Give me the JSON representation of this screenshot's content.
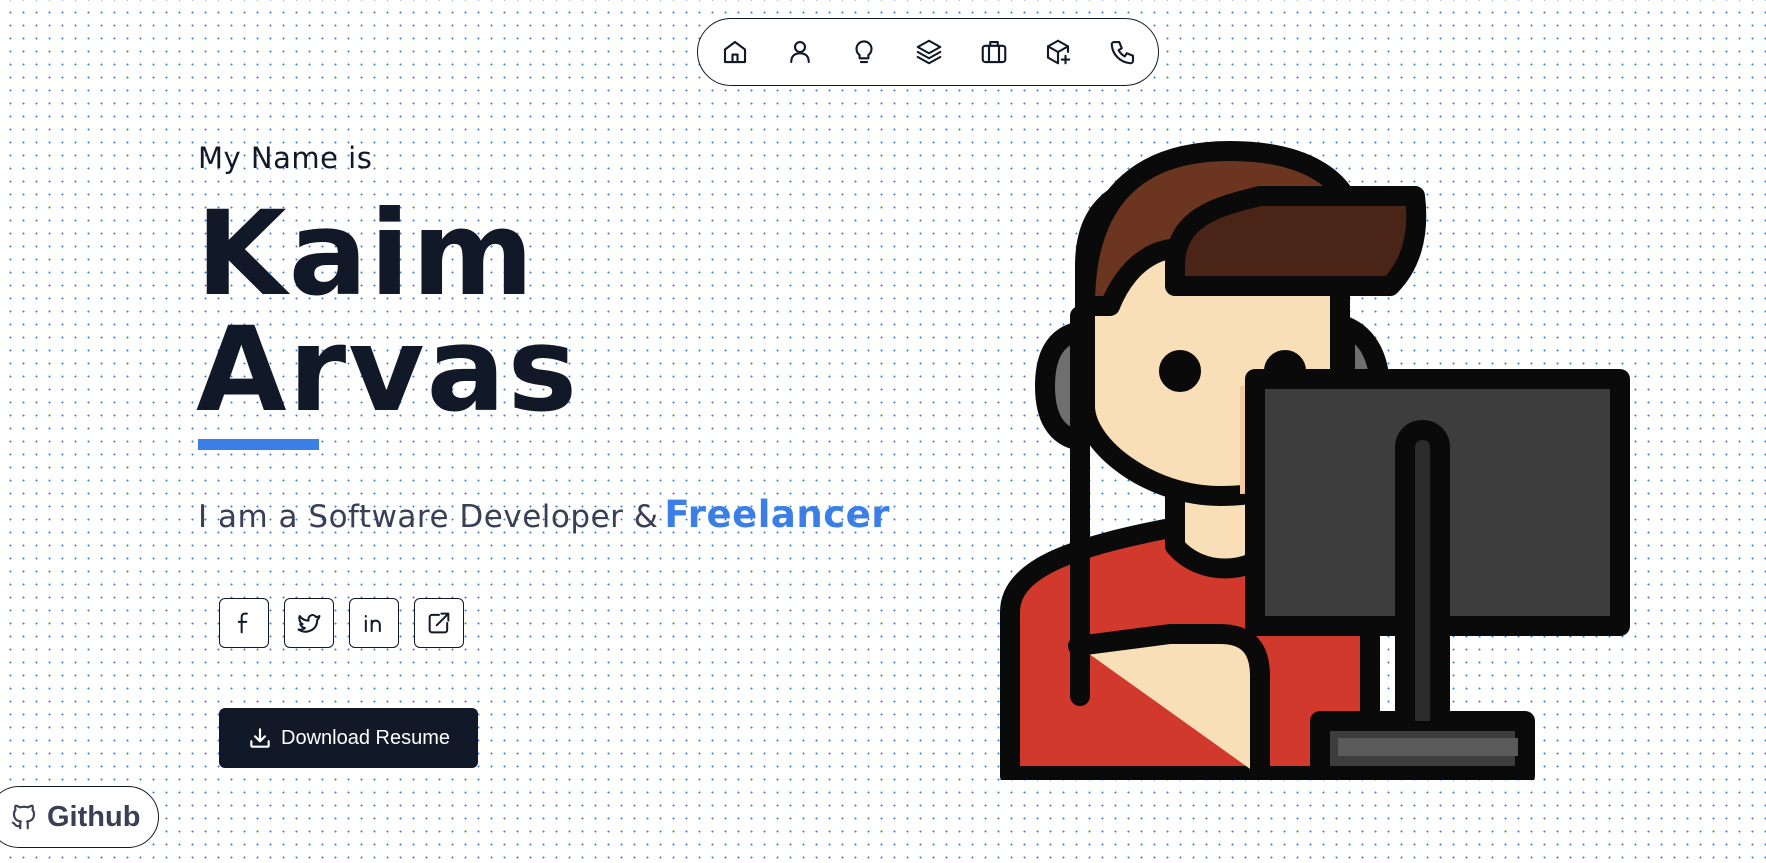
{
  "nav": {
    "items": [
      {
        "icon": "home-icon"
      },
      {
        "icon": "user-icon"
      },
      {
        "icon": "lightbulb-icon"
      },
      {
        "icon": "layers-icon"
      },
      {
        "icon": "briefcase-icon"
      },
      {
        "icon": "box-add-icon"
      },
      {
        "icon": "phone-icon"
      }
    ]
  },
  "hero": {
    "intro": "My Name is",
    "first_name": "Kaim",
    "last_name": "Arvas",
    "tagline_prefix": "I am a Software Developer &",
    "tagline_accent": "Freelancer"
  },
  "social": [
    {
      "icon": "facebook-icon"
    },
    {
      "icon": "twitter-icon"
    },
    {
      "icon": "linkedin-icon"
    },
    {
      "icon": "external-link-icon"
    }
  ],
  "download_button": {
    "label": "Download Resume",
    "icon": "download-icon"
  },
  "github_button": {
    "label": "Github",
    "icon": "github-icon"
  },
  "colors": {
    "accent": "#3b7fe6",
    "dark": "#111827",
    "dots": "#3b7fd9",
    "shirt": "#d0392b",
    "hair": "#5a2d1a",
    "skin": "#f9dfb7"
  }
}
